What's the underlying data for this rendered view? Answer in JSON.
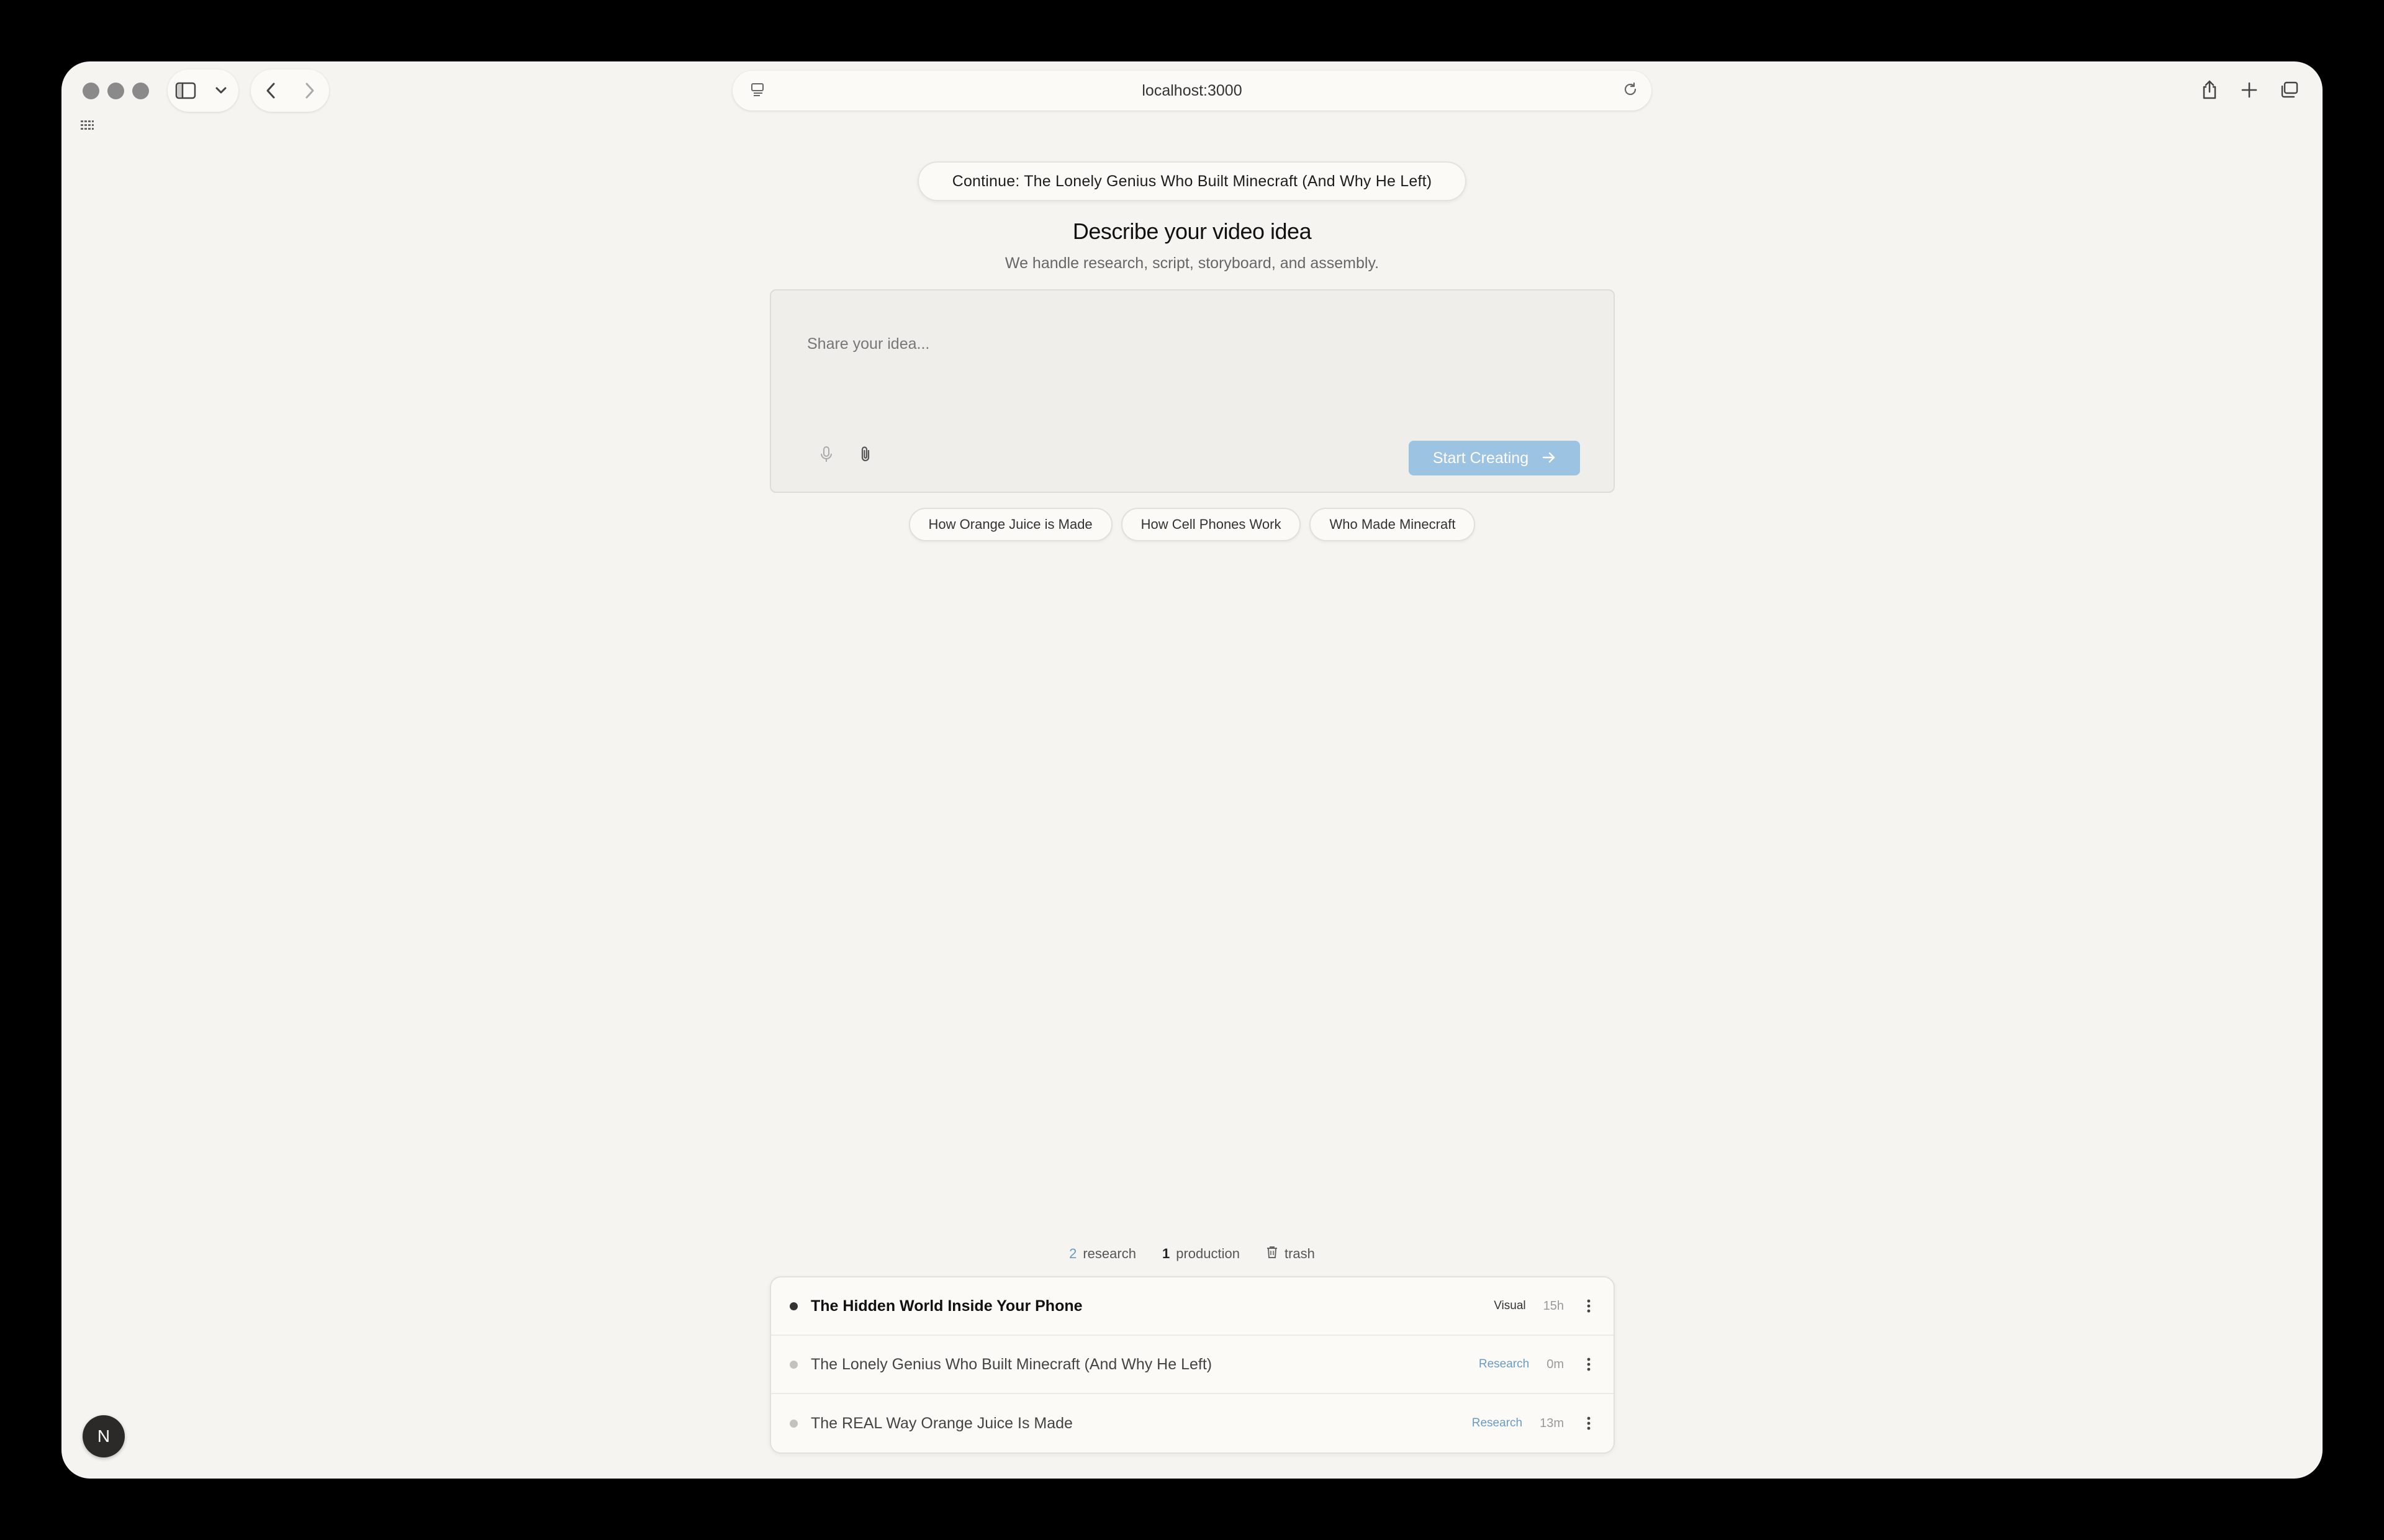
{
  "browser": {
    "url": "localhost:3000"
  },
  "main": {
    "continue_label": "Continue: The Lonely Genius Who Built Minecraft (And Why He Left)",
    "heading": "Describe your video idea",
    "subheading": "We handle research, script, storyboard, and assembly.",
    "idea_input": {
      "placeholder": "Share your idea...",
      "value": ""
    },
    "start_button": "Start Creating",
    "suggestions": [
      "How Orange Juice is Made",
      "How Cell Phones Work",
      "Who Made Minecraft"
    ]
  },
  "stats": {
    "research_count": "2",
    "research_label": "research",
    "production_count": "1",
    "production_label": "production",
    "trash_label": "trash"
  },
  "projects": [
    {
      "title": "The Hidden World Inside Your Phone",
      "tag": "Visual",
      "time": "15h",
      "active": true
    },
    {
      "title": "The Lonely Genius Who Built Minecraft (And Why He Left)",
      "tag": "Research",
      "time": "0m",
      "active": false
    },
    {
      "title": "The REAL Way Orange Juice Is Made",
      "tag": "Research",
      "time": "13m",
      "active": false
    }
  ],
  "avatar_initial": "N",
  "colors": {
    "background": "#f5f4f0",
    "accent_button": "#9cc3e2",
    "research_tag": "#6a9bc4",
    "active_dot": "#333333",
    "inactive_dot": "#bdbbb6"
  },
  "icons": {
    "window": [
      "traffic-light",
      "sidebar-icon",
      "chevron-down-icon",
      "back-icon",
      "forward-icon",
      "site-settings-icon",
      "reload-icon",
      "share-icon",
      "new-tab-icon",
      "tabs-overview-icon",
      "grid-icon"
    ],
    "composer": [
      "microphone-icon",
      "paperclip-icon",
      "arrow-right-icon"
    ],
    "list": [
      "trash-icon",
      "kebab-menu-icon"
    ]
  }
}
